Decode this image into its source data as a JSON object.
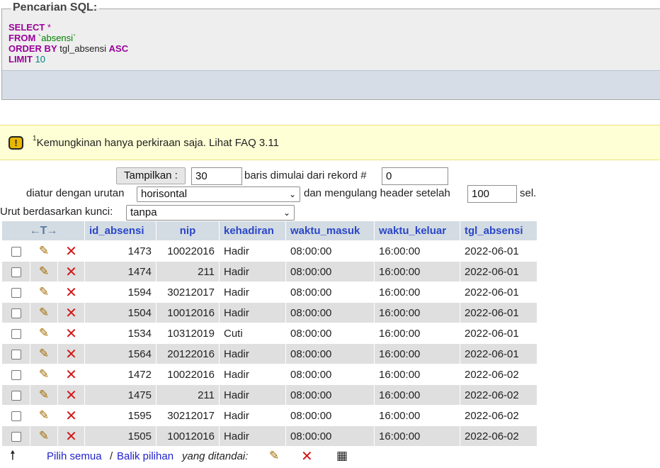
{
  "sql": {
    "legend": "Pencarian SQL:",
    "kw_select": "SELECT",
    "star": "*",
    "kw_from": "FROM",
    "table": "`absensi`",
    "kw_order": "ORDER BY",
    "order_col": "tgl_absensi",
    "kw_asc": "ASC",
    "kw_limit": "LIMIT",
    "limit_val": "10"
  },
  "notice": {
    "icon": "!",
    "sup": "1",
    "text": "Kemungkinan hanya perkiraan saja. Lihat FAQ 3.11"
  },
  "nav": {
    "show_button": "Tampilkan :",
    "rows_value": "30",
    "rows_label": "baris dimulai dari rekord #",
    "start_value": "0",
    "order_label": "diatur dengan urutan",
    "mode_value": "horisontal",
    "repeat_label": "dan mengulang header setelah",
    "repeat_value": "100",
    "cells_label": "sel.",
    "sort_label": "Urut berdasarkan kunci:",
    "sort_value": "tanpa"
  },
  "table": {
    "arrows": "←T→",
    "columns": [
      "id_absensi",
      "nip",
      "kehadiran",
      "waktu_masuk",
      "waktu_keluar",
      "tgl_absensi"
    ],
    "rows": [
      {
        "id": "1473",
        "nip": "10022016",
        "kehadiran": "Hadir",
        "masuk": "08:00:00",
        "keluar": "16:00:00",
        "tgl": "2022-06-01"
      },
      {
        "id": "1474",
        "nip": "211",
        "kehadiran": "Hadir",
        "masuk": "08:00:00",
        "keluar": "16:00:00",
        "tgl": "2022-06-01"
      },
      {
        "id": "1594",
        "nip": "30212017",
        "kehadiran": "Hadir",
        "masuk": "08:00:00",
        "keluar": "16:00:00",
        "tgl": "2022-06-01"
      },
      {
        "id": "1504",
        "nip": "10012016",
        "kehadiran": "Hadir",
        "masuk": "08:00:00",
        "keluar": "16:00:00",
        "tgl": "2022-06-01"
      },
      {
        "id": "1534",
        "nip": "10312019",
        "kehadiran": "Cuti",
        "masuk": "08:00:00",
        "keluar": "16:00:00",
        "tgl": "2022-06-01"
      },
      {
        "id": "1564",
        "nip": "20122016",
        "kehadiran": "Hadir",
        "masuk": "08:00:00",
        "keluar": "16:00:00",
        "tgl": "2022-06-01"
      },
      {
        "id": "1472",
        "nip": "10022016",
        "kehadiran": "Hadir",
        "masuk": "08:00:00",
        "keluar": "16:00:00",
        "tgl": "2022-06-02"
      },
      {
        "id": "1475",
        "nip": "211",
        "kehadiran": "Hadir",
        "masuk": "08:00:00",
        "keluar": "16:00:00",
        "tgl": "2022-06-02"
      },
      {
        "id": "1595",
        "nip": "30212017",
        "kehadiran": "Hadir",
        "masuk": "08:00:00",
        "keluar": "16:00:00",
        "tgl": "2022-06-02"
      },
      {
        "id": "1505",
        "nip": "10012016",
        "kehadiran": "Hadir",
        "masuk": "08:00:00",
        "keluar": "16:00:00",
        "tgl": "2022-06-02"
      }
    ]
  },
  "footer": {
    "select_all": "Pilih semua",
    "separator": "/",
    "invert": "Balik pilihan",
    "marked": "yang ditandai:"
  },
  "icons": {
    "warning": "warning-icon",
    "edit": "pencil-icon",
    "delete": "delete-x-icon",
    "export": "export-icon",
    "arrow_up": "arrow-up-icon"
  },
  "colors": {
    "link": "#2222cc",
    "header_bg": "#d3dce3",
    "row_alt": "#dfdfdf",
    "notice_bg": "#ffffd5",
    "delete": "#d41515"
  }
}
